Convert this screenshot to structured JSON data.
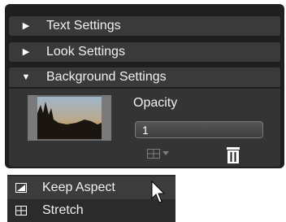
{
  "sections": [
    {
      "label": "Text Settings",
      "expanded": false
    },
    {
      "label": "Look Settings",
      "expanded": false
    },
    {
      "label": "Background Settings",
      "expanded": true
    }
  ],
  "background": {
    "opacity_label": "Opacity",
    "opacity_value": "1"
  },
  "fit_menu": {
    "items": [
      {
        "label": "Keep Aspect",
        "icon": "keep-aspect-icon",
        "highlighted": true
      },
      {
        "label": "Stretch",
        "icon": "stretch-icon",
        "highlighted": false
      }
    ]
  },
  "colors": {
    "panel_bg": "#1f1f1f",
    "header_bg": "#3a3a3a",
    "body_bg": "#343434",
    "text": "#f0f0f0"
  }
}
